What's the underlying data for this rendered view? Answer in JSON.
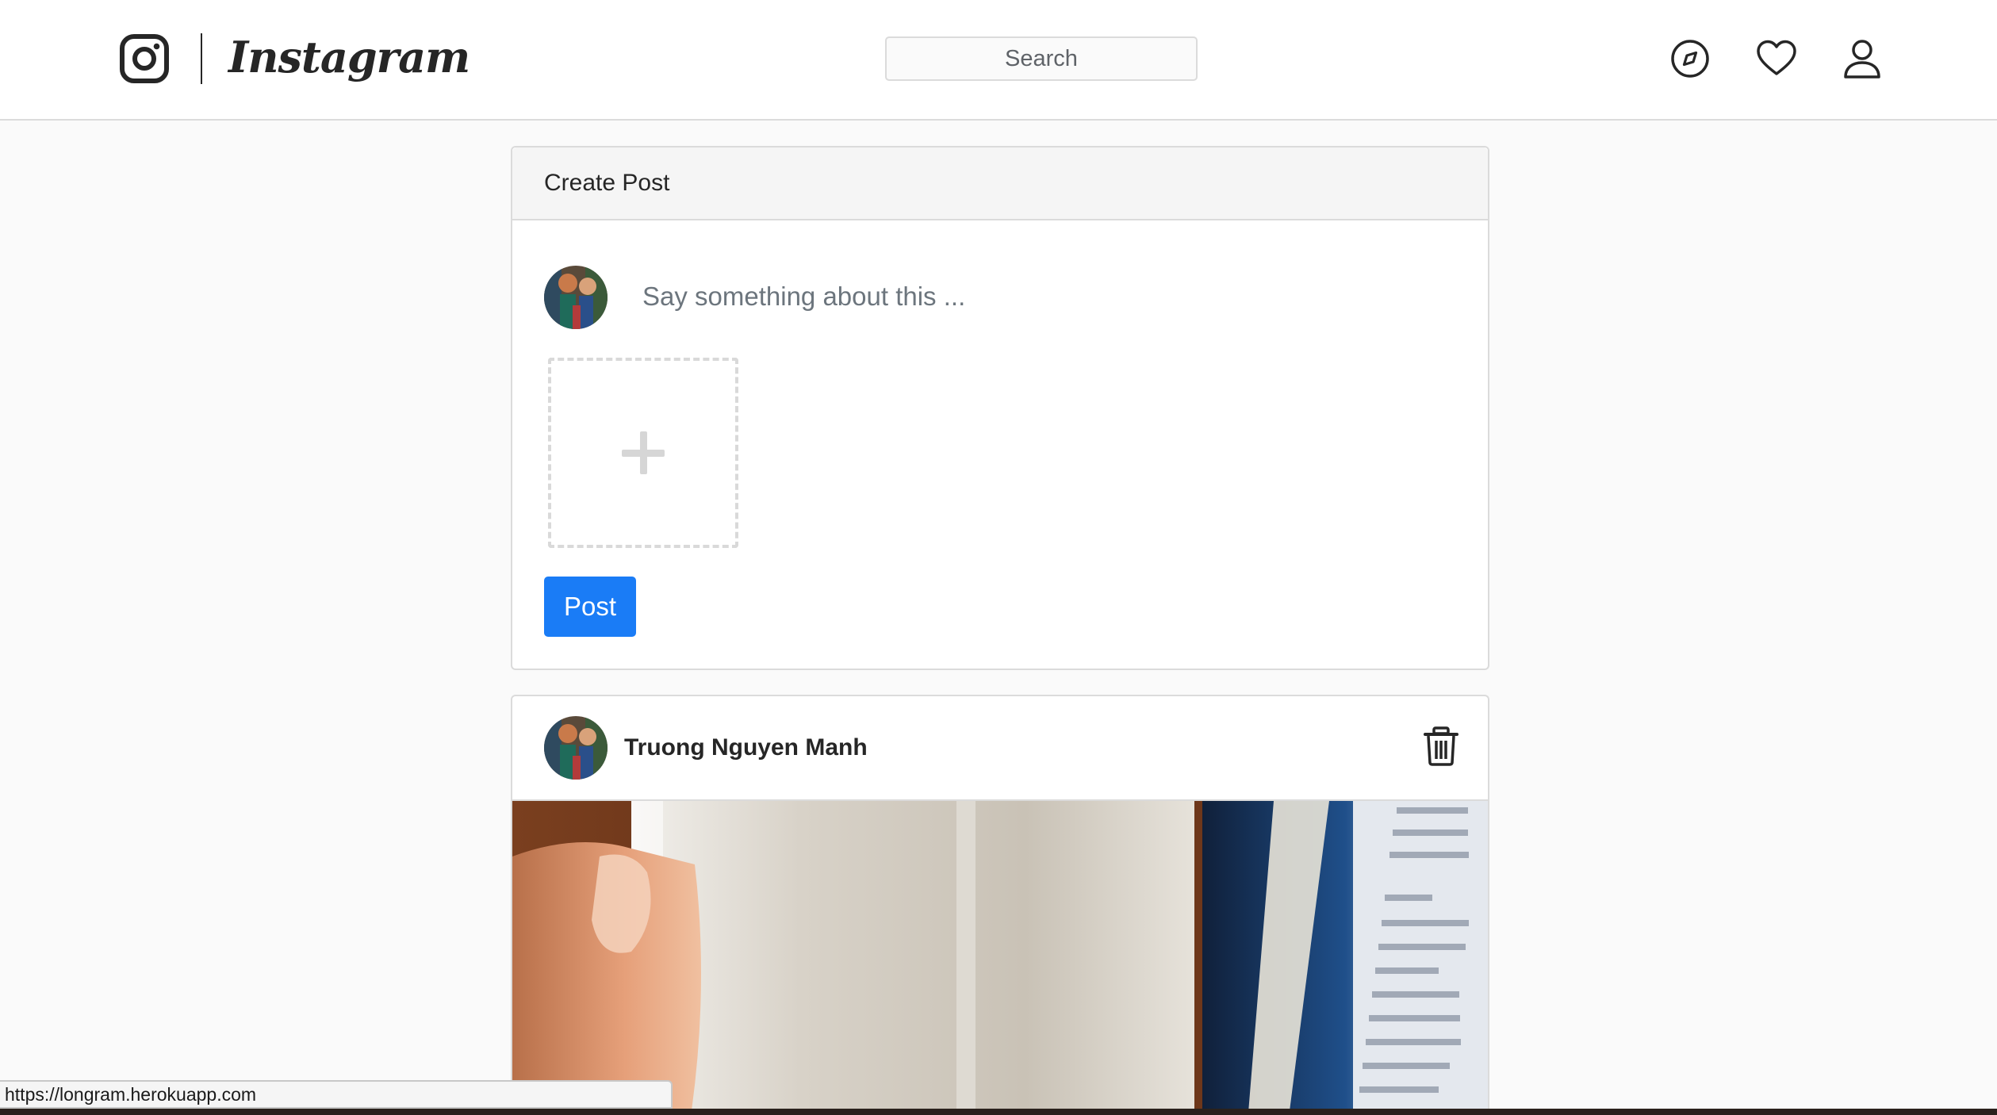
{
  "header": {
    "logo_icon": "instagram-camera-icon",
    "logo_text": "Instagram",
    "search_placeholder": "Search",
    "nav_icons": [
      "explore-compass-icon",
      "heart-icon",
      "profile-icon"
    ]
  },
  "create_post": {
    "title": "Create Post",
    "composer_placeholder": "Say something about this ...",
    "upload_icon": "plus-icon",
    "post_button": "Post"
  },
  "post": {
    "author": "Truong Nguyen Manh",
    "delete_icon": "trash-icon",
    "image_description_colors": {
      "primary_button": "#1a7cf6",
      "border": "#dbdbdb",
      "background": "#fafafa"
    }
  },
  "status_bar": {
    "url": "https://longram.herokuapp.com"
  }
}
